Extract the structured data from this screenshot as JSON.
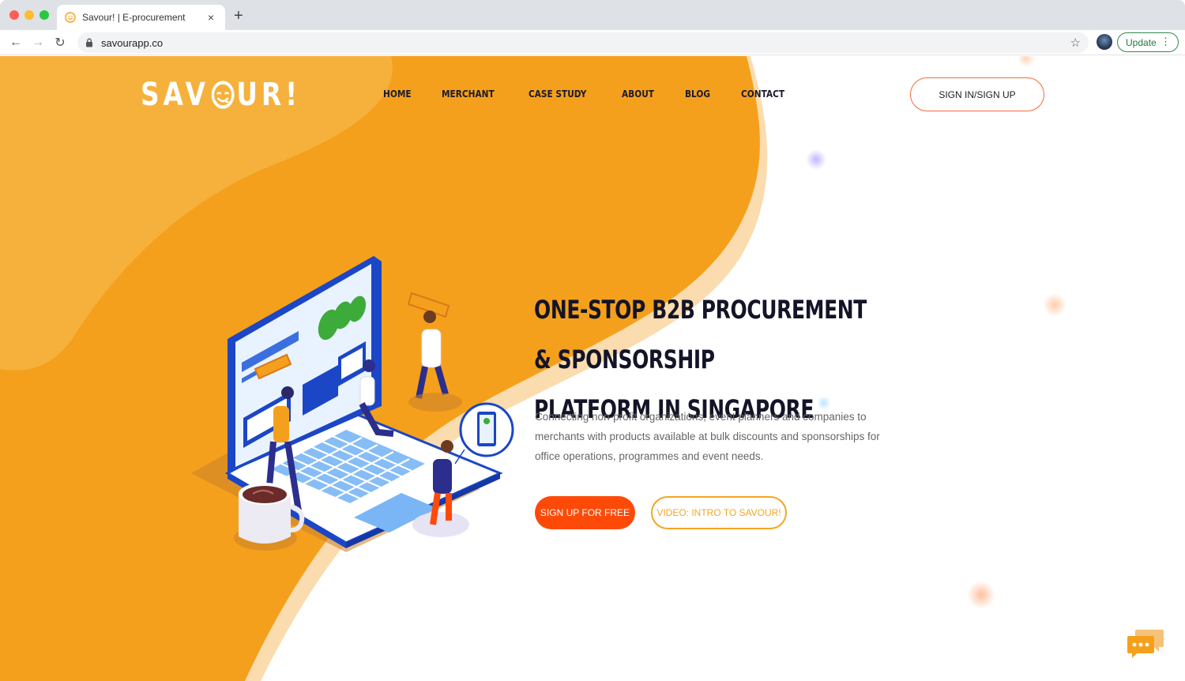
{
  "browser": {
    "tab_title": "Savour! | E-procurement",
    "tab_close": "×",
    "new_tab": "+",
    "url": "savourapp.co",
    "back": "←",
    "forward": "→",
    "reload": "↻",
    "bookmark": "☆",
    "update_label": "Update",
    "update_menu": "⋮"
  },
  "site": {
    "logo_left": "SAV",
    "logo_right": "UR!",
    "nav": [
      "HOME",
      "MERCHANT",
      "CASE STUDY",
      "ABOUT",
      "BLOG",
      "CONTACT"
    ],
    "signin_label": "SIGN IN/SIGN UP"
  },
  "hero": {
    "title_line1": "ONE-STOP B2B PROCUREMENT & SPONSORSHIP",
    "title_line2": "PLATFORM IN SINGAPORE",
    "description": "Connecting non-profit organizations, event planners and companies to merchants with products available at bulk discounts and sponsorships for office operations, programmes and event needs.",
    "cta_primary": "SIGN UP FOR FREE",
    "cta_secondary": "VIDEO: INTRO TO SAVOUR!"
  },
  "colors": {
    "brand_orange": "#f5a01c",
    "cta_orange": "#fe4a08",
    "secondary_border": "#f5a623",
    "text_dark": "#141428"
  },
  "icons": {
    "favicon": "smiley-icon",
    "lock": "lock-icon",
    "chat": "chat-bubble-icon"
  }
}
